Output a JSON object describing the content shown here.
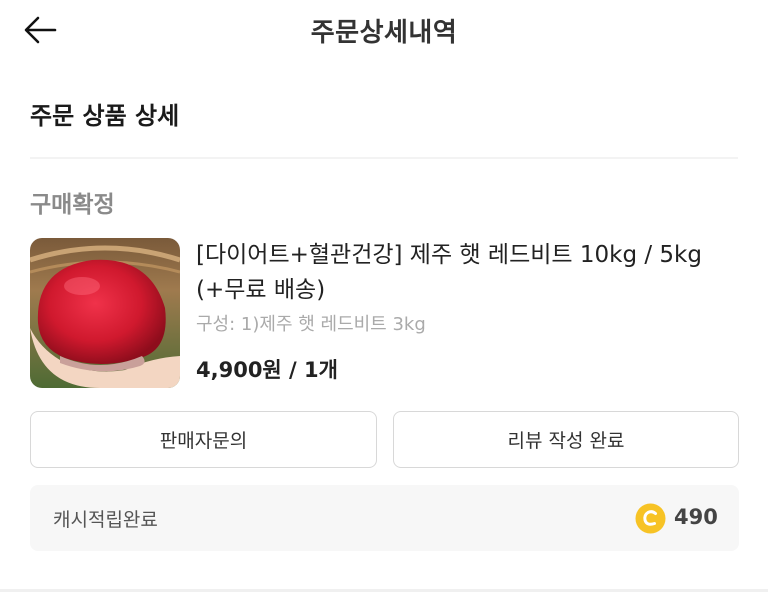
{
  "header": {
    "title": "주문상세내역",
    "back_icon": "arrow-left-icon"
  },
  "section": {
    "title": "주문 상품 상세"
  },
  "order": {
    "status": "구매확정",
    "product_name": "[다이어트+혈관건강] 제주 햇 레드비트 10kg / 5kg (+무료 배송)",
    "option": "구성: 1)제주 햇 레드비트 3kg",
    "price": "4,900원 / 1개"
  },
  "actions": {
    "seller_inquiry": "판매자문의",
    "review_done": "리뷰 작성 완료"
  },
  "cashback": {
    "label": "캐시적립완료",
    "coin_icon": "coin-icon",
    "amount": "490",
    "coin_color": "#f7c325"
  }
}
